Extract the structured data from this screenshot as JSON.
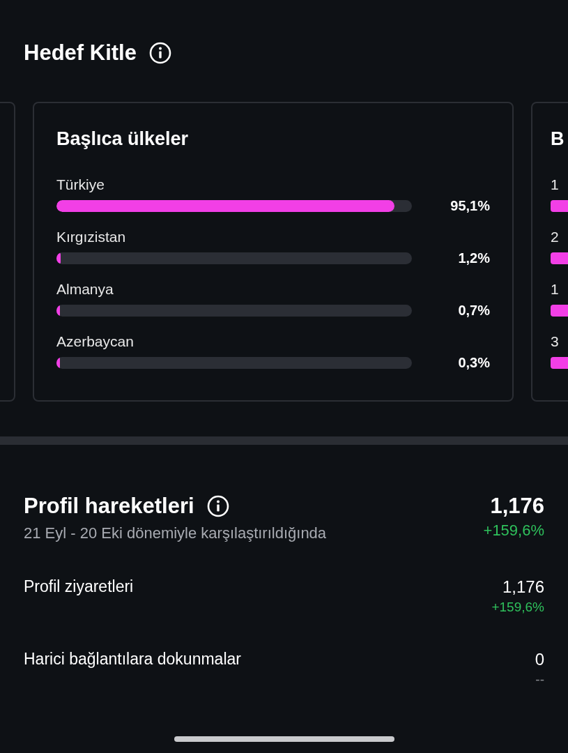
{
  "audience": {
    "title": "Hedef Kitle"
  },
  "countries_card": {
    "title": "Başlıca ülkeler",
    "rows": [
      {
        "name": "Türkiye",
        "level": 0.951,
        "value": "95,1%"
      },
      {
        "name": "Kırgızistan",
        "level": 0.012,
        "value": "1,2%"
      },
      {
        "name": "Almanya",
        "level": 0.007,
        "value": "0,7%"
      },
      {
        "name": "Azerbaycan",
        "level": 0.003,
        "value": "0,3%"
      }
    ]
  },
  "next_card": {
    "title": "B",
    "rows": [
      "1",
      "2",
      "1",
      "3"
    ]
  },
  "profile": {
    "title": "Profil hareketleri",
    "subtitle": "21 Eyl - 20 Eki dönemiyle karşılaştırıldığında",
    "total": "1,176",
    "change": "+159,6%",
    "metrics": [
      {
        "label": "Profil ziyaretleri",
        "value": "1,176",
        "change": "+159,6%",
        "kind": "up"
      },
      {
        "label": "Harici bağlantılara dokunmalar",
        "value": "0",
        "change": "--",
        "kind": "none"
      }
    ]
  }
}
